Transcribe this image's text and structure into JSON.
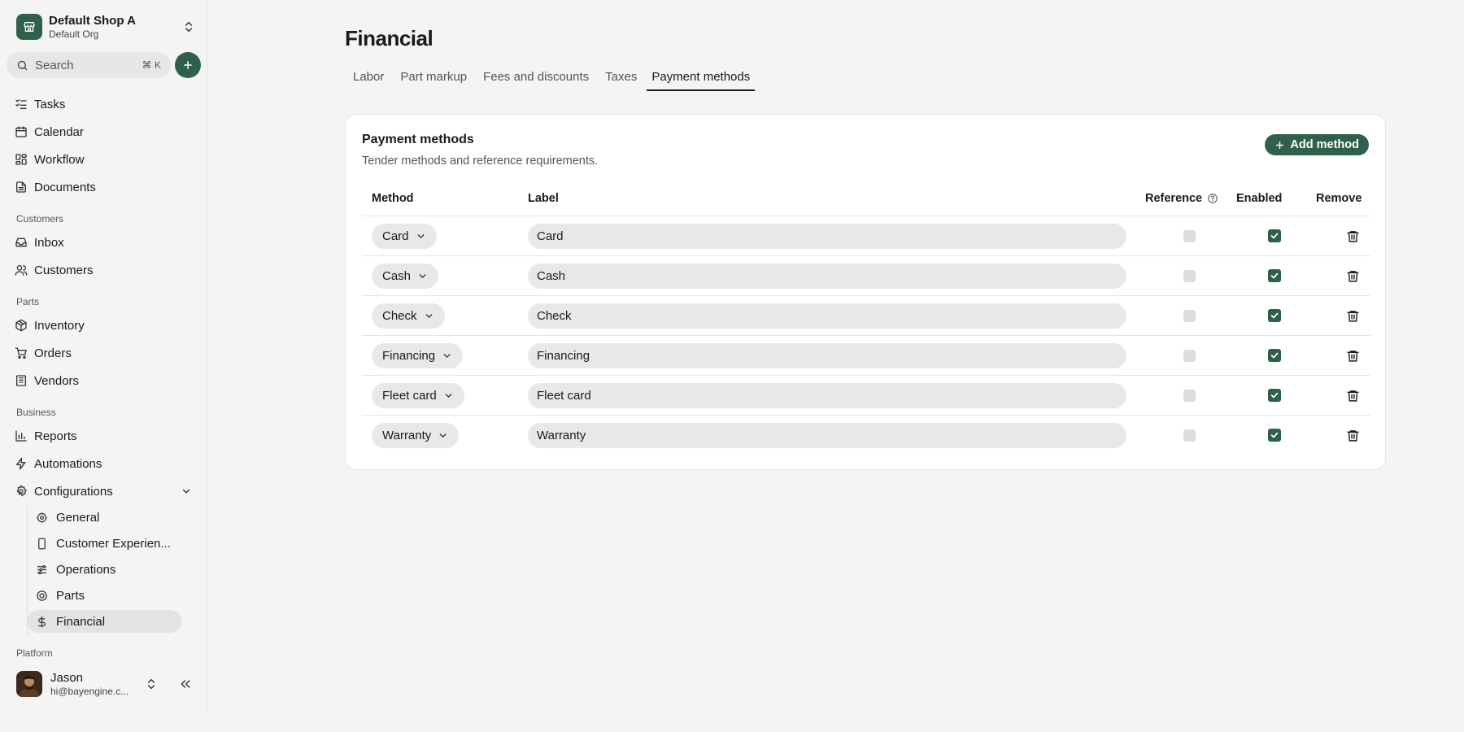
{
  "shop": {
    "name": "Default Shop A",
    "org": "Default Org"
  },
  "search": {
    "placeholder": "Search",
    "shortcut": "⌘ K"
  },
  "nav": {
    "main": [
      "Tasks",
      "Calendar",
      "Workflow",
      "Documents"
    ],
    "customers_label": "Customers",
    "customers": [
      "Inbox",
      "Customers"
    ],
    "parts_label": "Parts",
    "parts": [
      "Inventory",
      "Orders",
      "Vendors"
    ],
    "business_label": "Business",
    "business": [
      "Reports",
      "Automations",
      "Configurations"
    ],
    "config_items": [
      "General",
      "Customer Experien...",
      "Operations",
      "Parts",
      "Financial"
    ],
    "platform_label": "Platform"
  },
  "user": {
    "name": "Jason",
    "email": "hi@bayengine.c..."
  },
  "page": {
    "title": "Financial"
  },
  "tabs": [
    "Labor",
    "Part markup",
    "Fees and discounts",
    "Taxes",
    "Payment methods"
  ],
  "card": {
    "title": "Payment methods",
    "subtitle": "Tender methods and reference requirements.",
    "add_label": "Add method",
    "headers": {
      "method": "Method",
      "label": "Label",
      "reference": "Reference",
      "enabled": "Enabled",
      "remove": "Remove"
    },
    "rows": [
      {
        "method": "Card",
        "label": "Card",
        "reference": false,
        "enabled": true
      },
      {
        "method": "Cash",
        "label": "Cash",
        "reference": false,
        "enabled": true
      },
      {
        "method": "Check",
        "label": "Check",
        "reference": false,
        "enabled": true
      },
      {
        "method": "Financing",
        "label": "Financing",
        "reference": false,
        "enabled": true
      },
      {
        "method": "Fleet card",
        "label": "Fleet card",
        "reference": false,
        "enabled": true
      },
      {
        "method": "Warranty",
        "label": "Warranty",
        "reference": false,
        "enabled": true
      }
    ]
  },
  "colors": {
    "accent": "#2f6049",
    "background": "#f3f4f3"
  }
}
